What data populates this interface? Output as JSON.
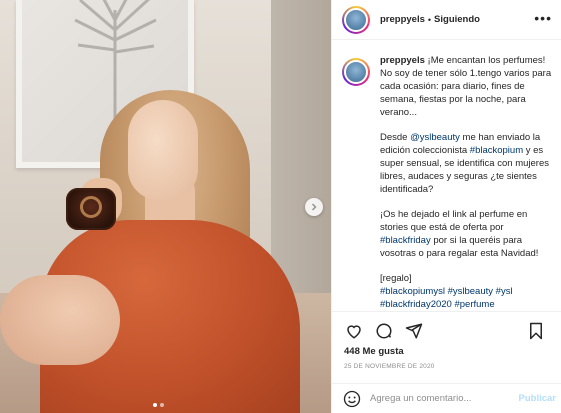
{
  "post": {
    "username": "preppyels",
    "follow_status": "Siguiendo",
    "caption": {
      "username": "preppyels",
      "p1": "¡Me encantan los perfumes! No soy de tener sólo 1.tengo varios para cada ocasión: para diario, fines de semana, fiestas por la noche, para verano...",
      "p2_a": "Desde ",
      "p2_mention": "@yslbeauty",
      "p2_b": " me han enviado la edición coleccionista ",
      "p2_tag": "#blackopium",
      "p2_c": " y es super sensual, se identifica con mujeres libres, audaces y seguras ¿te sientes identificada?",
      "p3_a": "¡Os he dejado el link al perfume en stories que está de oferta por ",
      "p3_tag": "#blackfriday",
      "p3_b": " por si la queréis para vosotras o para regalar esta Navidad!",
      "p4": "[regalo]",
      "tags": [
        "#blackopiumysl",
        "#yslbeauty",
        "#ysl",
        "#blackfriday2020",
        "#perfume"
      ]
    },
    "likes": "448 Me gusta",
    "date": "25 DE NOVIEMBRE DE 2020",
    "comment_placeholder": "Agrega un comentario...",
    "publish_label": "Publicar",
    "carousel": {
      "slides": 2,
      "active": 0
    }
  },
  "icons": {
    "more": "more-options-icon",
    "like": "heart-icon",
    "comment": "comment-icon",
    "share": "share-icon",
    "save": "bookmark-icon",
    "emoji": "emoji-icon",
    "next": "chevron-right-icon"
  },
  "colors": {
    "link": "#00376b",
    "publish": "#b2dffc",
    "muted": "#8e8e8e"
  }
}
